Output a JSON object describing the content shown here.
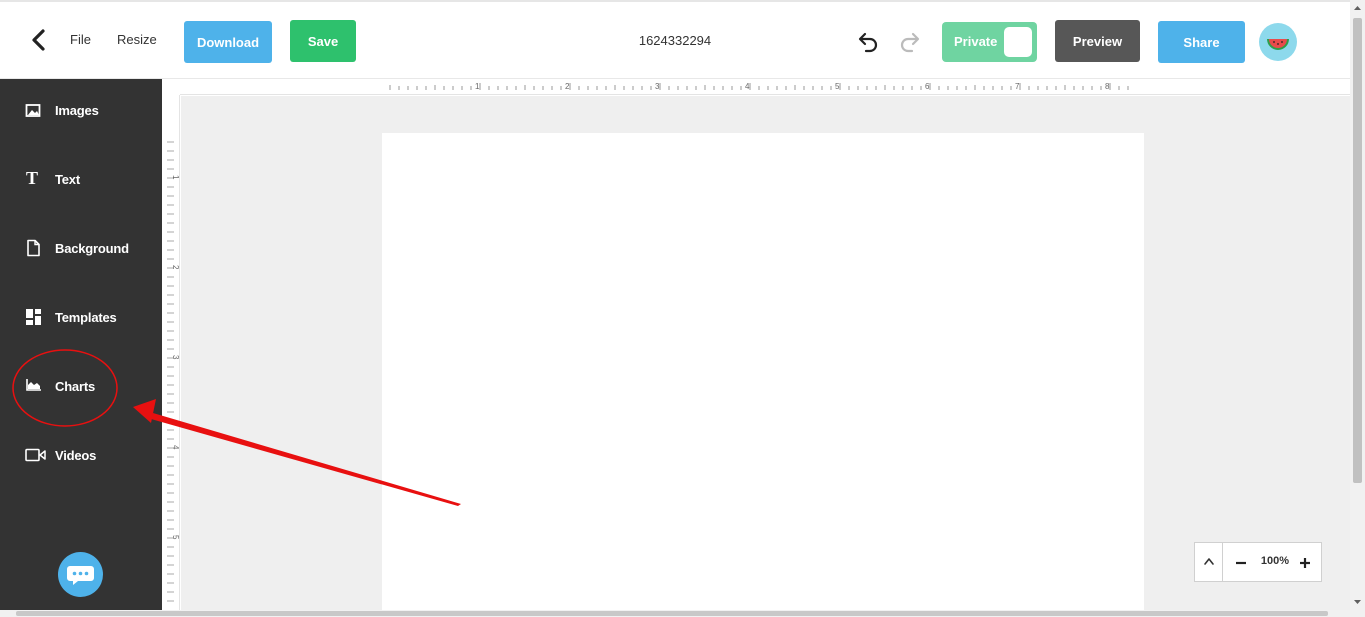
{
  "header": {
    "menu": {
      "file": "File",
      "resize": "Resize"
    },
    "buttons": {
      "download": "Download",
      "save": "Save",
      "preview": "Preview",
      "share": "Share"
    },
    "document_title": "1624332294",
    "privacy_toggle": {
      "label": "Private",
      "checked": true
    }
  },
  "sidebar": {
    "items": [
      {
        "label": "Images",
        "icon": "image-icon"
      },
      {
        "label": "Text",
        "icon": "text-icon"
      },
      {
        "label": "Background",
        "icon": "document-icon"
      },
      {
        "label": "Templates",
        "icon": "templates-icon"
      },
      {
        "label": "Charts",
        "icon": "chart-icon"
      },
      {
        "label": "Videos",
        "icon": "video-icon"
      }
    ],
    "chat_icon": "chat-bubble-icon"
  },
  "rulers": {
    "horizontal_labels": [
      "1",
      "2",
      "3",
      "4",
      "5",
      "6",
      "7",
      "8"
    ],
    "vertical_labels": [
      "1",
      "2",
      "3",
      "4",
      "5"
    ]
  },
  "zoom": {
    "level": "100%"
  },
  "colors": {
    "download": "#4eb2ea",
    "save": "#2ec16d",
    "private": "#6fd4a1",
    "preview": "#575757",
    "share": "#4eb2ea",
    "sidebar": "#333333",
    "workspace": "#efefef",
    "annotation": "#e81010"
  }
}
